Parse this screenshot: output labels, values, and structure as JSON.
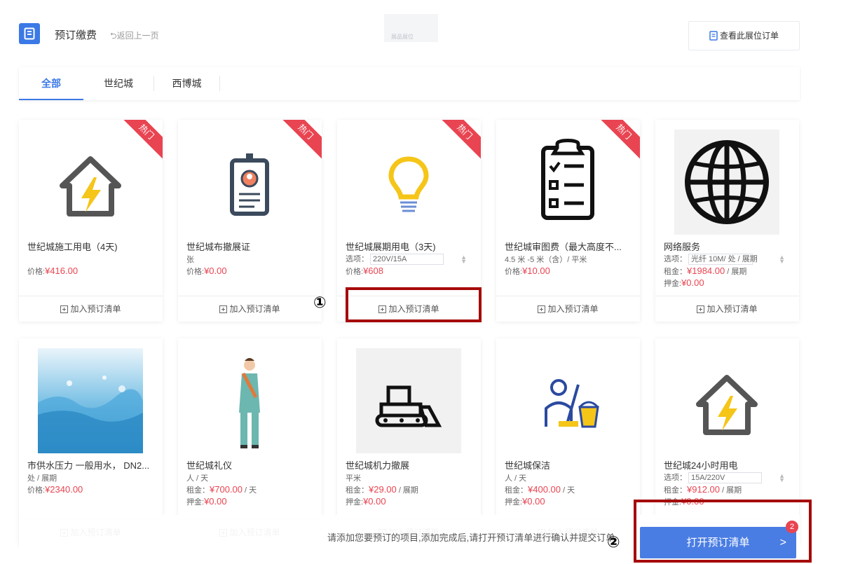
{
  "header": {
    "title": "预订缴费",
    "back_label": "⮌返回上一页",
    "center_text": "展品展位",
    "view_orders_label": "查看此展位订单"
  },
  "tabs": [
    {
      "label": "全部",
      "active": true
    },
    {
      "label": "世纪城"
    },
    {
      "label": "西博城"
    }
  ],
  "ribbon_label": "热门",
  "add_label": "加入预订清单",
  "option_prefix": "选项：",
  "products": [
    {
      "name": "世纪城施工用电（4天)",
      "price_label": "价格:",
      "price": "¥416.00",
      "icon": "house-lightning-icon",
      "hot": true
    },
    {
      "name": "世纪城布撤展证",
      "unit": "张",
      "price_label": "价格:",
      "price": "¥0.00",
      "icon": "id-badge-icon",
      "hot": true
    },
    {
      "name": "世纪城展期用电（3天)",
      "option": "220V/15A",
      "price_label": "价格:",
      "price": "¥608",
      "icon": "lightbulb-icon",
      "hot": true
    },
    {
      "name": "世纪城审图费（最大高度不...",
      "unit": "4.5 米 -5 米（含）/ 平米",
      "price_label": "价格:",
      "price": "¥10.00",
      "icon": "clipboard-checklist-icon",
      "hot": true
    },
    {
      "name": "网络服务",
      "option": "光纤 10M/ 处 / 展期",
      "rent_label": "租金：",
      "rent": "¥1984.00",
      "rent_unit": " / 展期",
      "deposit_label": "押金:",
      "deposit": "¥0.00",
      "icon": "globe-icon",
      "hot": false
    },
    {
      "name": "市供水压力 一般用水， DN2...",
      "unit": "处 / 展期",
      "price_label": "价格:",
      "price": "¥2340.00",
      "icon": "water-splash-image",
      "hot": false
    },
    {
      "name": "世纪城礼仪",
      "unit": "人 / 天",
      "rent_label": "租金：",
      "rent": "¥700.00",
      "rent_unit": " / 天",
      "deposit_label": "押金:",
      "deposit": "¥0.00",
      "icon": "hostess-icon",
      "hot": false
    },
    {
      "name": "世纪城机力撤展",
      "unit": "平米",
      "rent_label": "租金：",
      "rent": "¥29.00",
      "rent_unit": " / 展期",
      "deposit_label": "押金:",
      "deposit": "¥0.00",
      "icon": "bulldozer-icon",
      "hot": false
    },
    {
      "name": "世纪城保洁",
      "unit": "人 / 天",
      "rent_label": "租金：",
      "rent": "¥400.00",
      "rent_unit": " / 天",
      "deposit_label": "押金:",
      "deposit": "¥0.00",
      "icon": "cleaner-icon",
      "hot": false
    },
    {
      "name": "世纪城24小时用电",
      "option": "15A/220V",
      "rent_label": "租金：",
      "rent": "¥912.00",
      "rent_unit": " / 展期",
      "deposit_label": "押金:",
      "deposit": "¥0.00",
      "icon": "house-lightning-icon",
      "hot": false
    }
  ],
  "bottom": {
    "message": "请添加您要预订的项目,添加完成后,请打开预订清单进行确认并提交订单",
    "open_button": "打开预订清单",
    "badge_count": "2"
  },
  "annotations": [
    "①",
    "②"
  ],
  "colors": {
    "accent": "#3b79e6",
    "price": "#e94451",
    "annotation": "#a60a0a"
  }
}
